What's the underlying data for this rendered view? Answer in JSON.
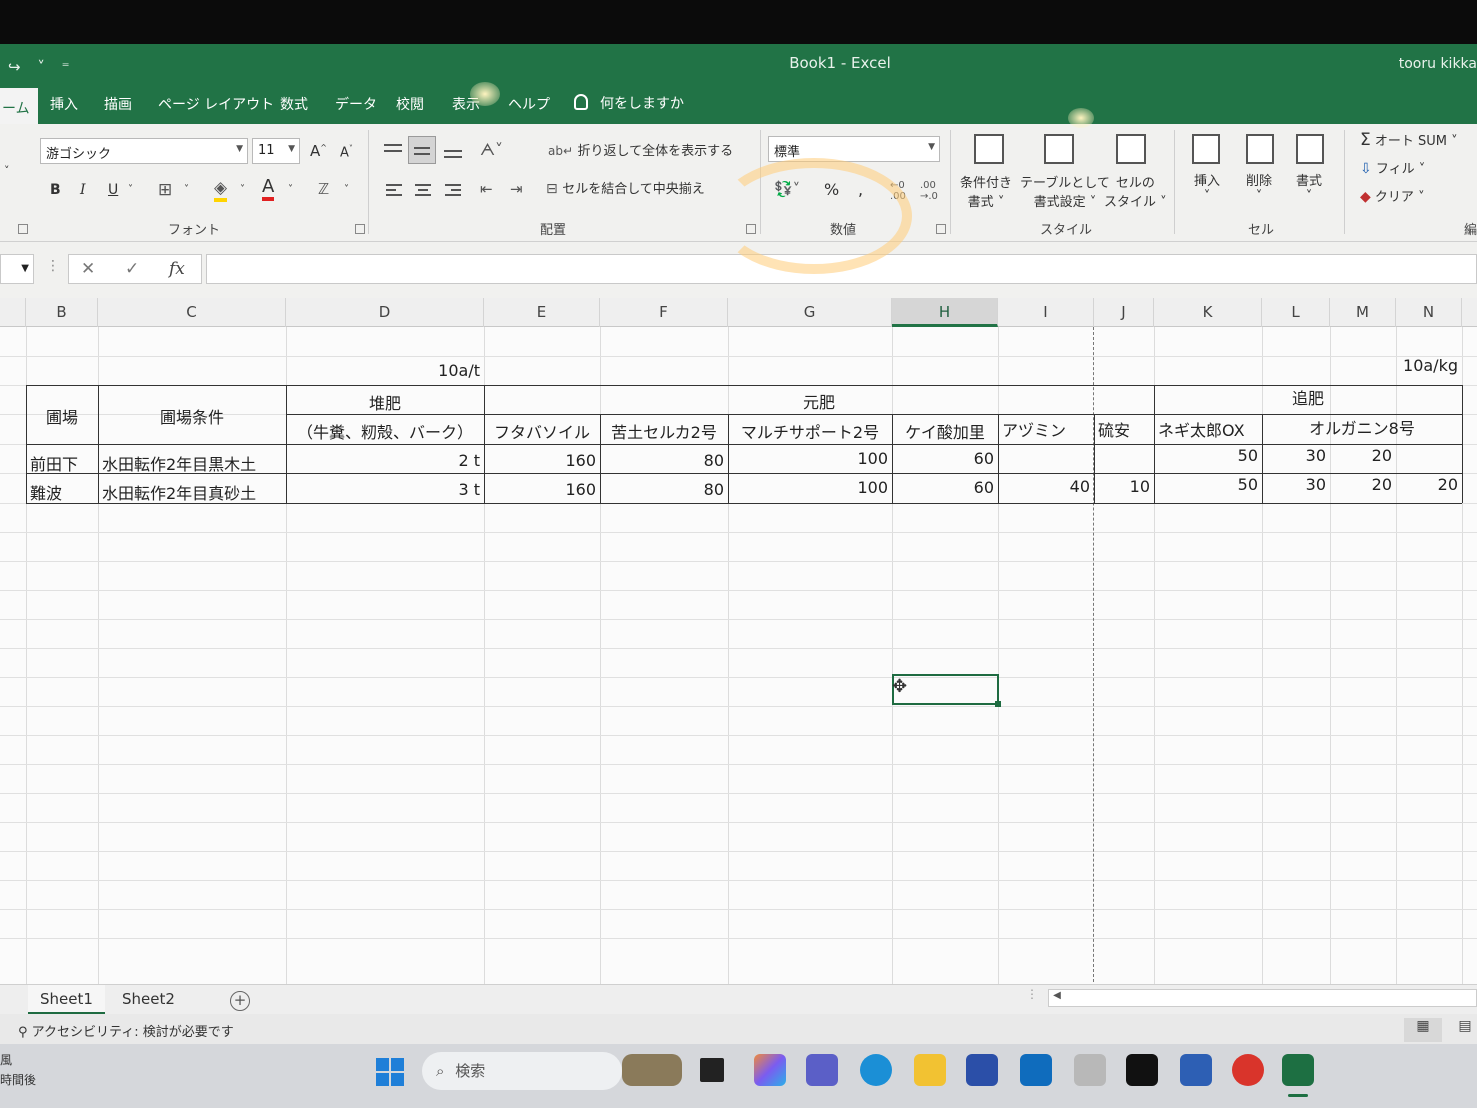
{
  "window": {
    "title": "Book1  -  Excel",
    "user": "tooru kikka"
  },
  "ribbon_tabs": {
    "home": "ーム",
    "insert": "挿入",
    "draw": "描画",
    "page_layout": "ページ レイアウト",
    "formulas": "数式",
    "data": "データ",
    "review": "校閲",
    "view": "表示",
    "help": "ヘルプ",
    "tell_me": "何をしますか"
  },
  "ribbon": {
    "font_name": "游ゴシック",
    "font_size": "11",
    "bold": "B",
    "italic": "I",
    "underline": "U",
    "grow_font": "A",
    "shrink_font": "A",
    "font_color": "A",
    "font_group": "フォント",
    "wrap_text": "折り返して全体を表示する",
    "merge_center": "セルを結合して中央揃え",
    "alignment_group": "配置",
    "number_format": "標準",
    "percent": "%",
    "comma": ",",
    "number_group": "数値",
    "cond_format": [
      "条件付き",
      "書式"
    ],
    "format_table": [
      "テーブルとして",
      "書式設定"
    ],
    "cell_styles": [
      "セルの",
      "スタイル"
    ],
    "styles_group": "スタイル",
    "insert_cells": "挿入",
    "delete_cells": "削除",
    "format_cells": "書式",
    "cells_group": "セル",
    "autosum": "オート SUM",
    "fill": "フィル",
    "clear": "クリア",
    "editing_group": "編"
  },
  "formula_bar": {
    "cancel": "✕",
    "enter": "✓",
    "fx": "fx",
    "value": ""
  },
  "columns": [
    "B",
    "C",
    "D",
    "E",
    "F",
    "G",
    "H",
    "I",
    "J",
    "K",
    "L",
    "M",
    "N"
  ],
  "sheet": {
    "unit_left": "10a/t",
    "unit_right": "10a/kg",
    "header": {
      "field": "圃場",
      "condition": "圃場条件",
      "compost": "堆肥",
      "compost_sub": "（牛糞、籾殻、バーク）",
      "base_fert": "元肥",
      "top_dress": "追肥",
      "futaba": "フタバソイル",
      "kudo": "苦土セルカ2号",
      "multi": "マルチサポート2号",
      "keisan": "ケイ酸加里",
      "azumin": "アヅミン",
      "ryuan": "硫安",
      "negi": "ネギ太郎OX",
      "organin": "オルガニン8号"
    },
    "rows": [
      {
        "field": "前田下",
        "condition": "水田転作2年目黒木土",
        "compost": "2 t",
        "futaba": "160",
        "kudo": "80",
        "multi": "100",
        "keisan": "60",
        "azumin": "",
        "ryuan": "",
        "negi": "50",
        "l": "30",
        "m": "20",
        "n": ""
      },
      {
        "field": "難波",
        "condition": "水田転作2年目真砂土",
        "compost": "3 t",
        "futaba": "160",
        "kudo": "80",
        "multi": "100",
        "keisan": "60",
        "azumin": "40",
        "ryuan": "10",
        "negi": "50",
        "l": "30",
        "m": "20",
        "n": "20"
      }
    ]
  },
  "sheet_tabs": [
    "Sheet1",
    "Sheet2"
  ],
  "add_sheet": "+",
  "status": {
    "accessibility": "アクセシビリティ: 検討が必要です"
  },
  "taskbar": {
    "weather_line1": "風",
    "weather_line2": "時間後",
    "search": "検索"
  }
}
